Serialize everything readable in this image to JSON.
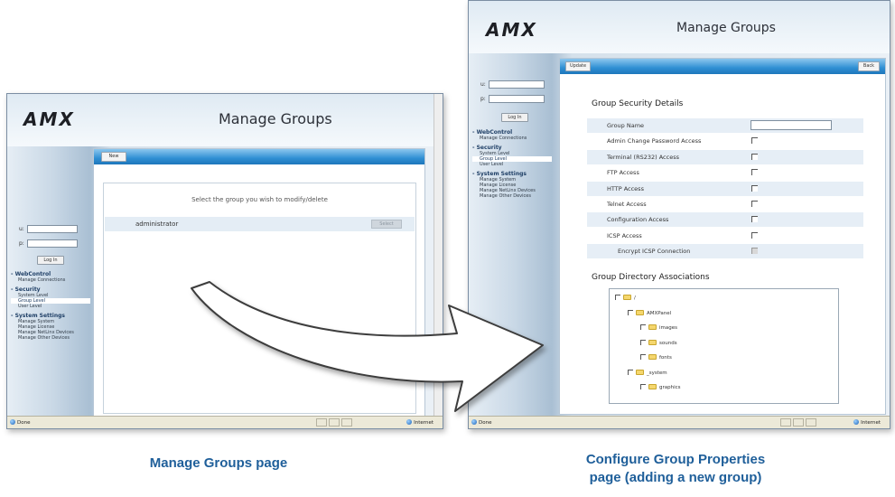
{
  "left_window": {
    "logo": "AMX",
    "page_title": "Manage Groups",
    "login": {
      "user_label": "u:",
      "pass_label": "p:",
      "login_button": "Log In"
    },
    "nav": [
      {
        "section": "- WebControl",
        "items": [
          {
            "label": "Manage Connections",
            "selected": false
          }
        ]
      },
      {
        "section": "- Security",
        "items": [
          {
            "label": "System Level",
            "selected": false
          },
          {
            "label": "Group Level",
            "selected": true
          },
          {
            "label": "User Level",
            "selected": false
          }
        ]
      },
      {
        "section": "- System Settings",
        "items": [
          {
            "label": "Manage System",
            "selected": false
          },
          {
            "label": "Manage License",
            "selected": false
          },
          {
            "label": "Manage NetLinx Devices",
            "selected": false
          },
          {
            "label": "Manage Other Devices",
            "selected": false
          }
        ]
      }
    ],
    "toolbar": {
      "new_button": "New"
    },
    "prompt": "Select the group you wish to modify/delete",
    "groups": [
      {
        "name": "administrator",
        "button": "Select"
      }
    ],
    "status": {
      "left": "Done",
      "zone": "Internet"
    }
  },
  "right_window": {
    "logo": "AMX",
    "page_title": "Manage Groups",
    "login": {
      "user_label": "u:",
      "pass_label": "p:",
      "login_button": "Log In"
    },
    "nav": [
      {
        "section": "- WebControl",
        "items": [
          {
            "label": "Manage Connections",
            "selected": false
          }
        ]
      },
      {
        "section": "- Security",
        "items": [
          {
            "label": "System Level",
            "selected": false
          },
          {
            "label": "Group Level",
            "selected": true
          },
          {
            "label": "User Level",
            "selected": false
          }
        ]
      },
      {
        "section": "- System Settings",
        "items": [
          {
            "label": "Manage System",
            "selected": false
          },
          {
            "label": "Manage License",
            "selected": false
          },
          {
            "label": "Manage NetLinx Devices",
            "selected": false
          },
          {
            "label": "Manage Other Devices",
            "selected": false
          }
        ]
      }
    ],
    "toolbar": {
      "update_button": "Update",
      "back_button": "Back"
    },
    "security_title": "Group Security Details",
    "fields": [
      {
        "label": "Group Name",
        "kind": "text",
        "value": ""
      },
      {
        "label": "Admin Change Password Access",
        "kind": "checkbox",
        "checked": false
      },
      {
        "label": "Terminal (RS232) Access",
        "kind": "checkbox",
        "checked": false
      },
      {
        "label": "FTP Access",
        "kind": "checkbox",
        "checked": false
      },
      {
        "label": "HTTP Access",
        "kind": "checkbox",
        "checked": false
      },
      {
        "label": "Telnet Access",
        "kind": "checkbox",
        "checked": false
      },
      {
        "label": "Configuration Access",
        "kind": "checkbox",
        "checked": false
      },
      {
        "label": "ICSP Access",
        "kind": "checkbox",
        "checked": false
      },
      {
        "label": "Encrypt ICSP Connection",
        "kind": "checkbox",
        "checked": false,
        "disabled": true
      }
    ],
    "directory_title": "Group Directory Associations",
    "tree": [
      {
        "name": "/",
        "depth": 0
      },
      {
        "name": "AMXPanel",
        "depth": 1
      },
      {
        "name": "images",
        "depth": 2
      },
      {
        "name": "sounds",
        "depth": 2
      },
      {
        "name": "fonts",
        "depth": 2
      },
      {
        "name": "_system",
        "depth": 1
      },
      {
        "name": "graphics",
        "depth": 2
      }
    ],
    "status": {
      "left": "Done",
      "zone": "Internet"
    }
  },
  "captions": {
    "left": "Manage Groups page",
    "right_line1": "Configure Group Properties",
    "right_line2": "page (adding a new group)"
  },
  "colors": {
    "toolbar_blue": "#2f8fd3",
    "caption_blue": "#1f5f9a",
    "row_shade": "#e6eef6"
  }
}
